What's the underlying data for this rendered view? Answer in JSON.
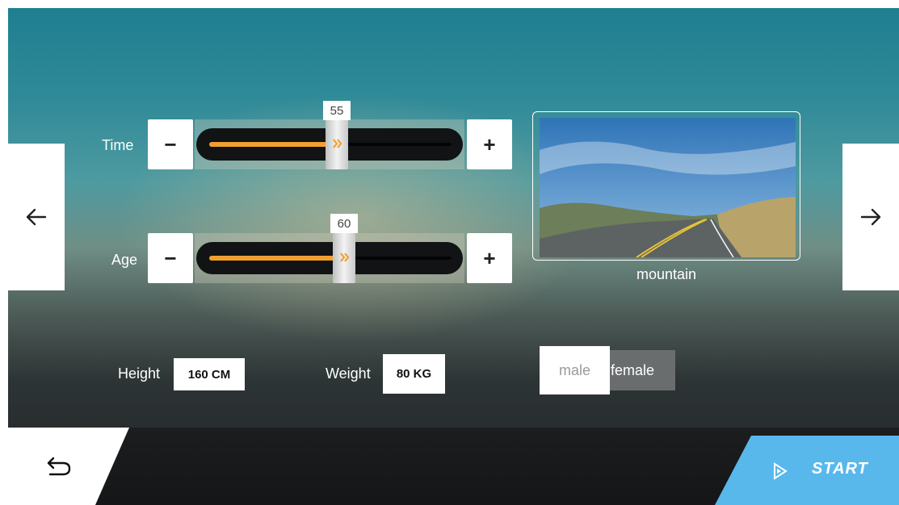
{
  "sliders": [
    {
      "label": "Time",
      "value": "55",
      "minus_label": "−",
      "plus_label": "+",
      "fill_fraction": 0.52
    },
    {
      "label": "Age",
      "value": "60",
      "minus_label": "−",
      "plus_label": "+",
      "fill_fraction": 0.55
    }
  ],
  "scene": {
    "label": "mountain"
  },
  "height": {
    "label": "Height",
    "value": "160 CM"
  },
  "weight": {
    "label": "Weight",
    "value": "80 KG"
  },
  "gender": {
    "male_label": "male",
    "female_label": "female",
    "selected": "male"
  },
  "start": {
    "label": "START"
  },
  "colors": {
    "accent": "#f0a030",
    "start_button": "#58b8ec"
  },
  "icons": {
    "left_nav": "arrow-left-icon",
    "right_nav": "arrow-right-icon",
    "back": "return-icon",
    "play": "play-icon"
  }
}
